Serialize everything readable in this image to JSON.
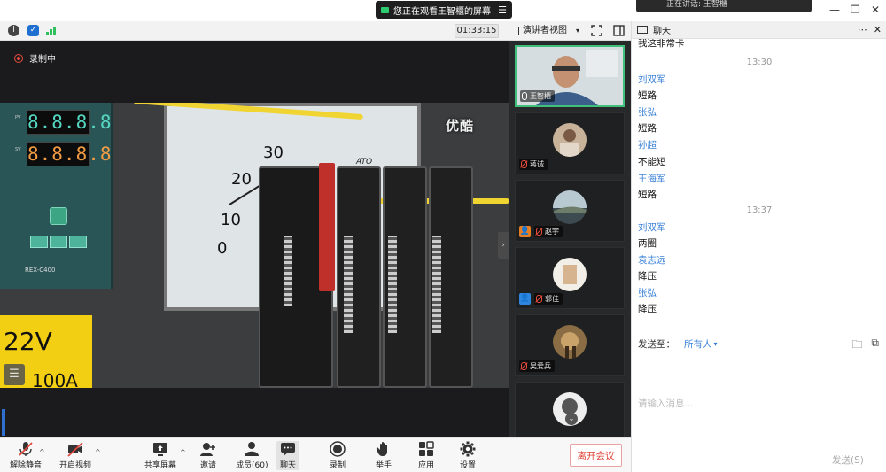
{
  "viewing_banner": {
    "text": "您正在观看王智櫃的屏幕"
  },
  "speaker_pill": {
    "text": "正在讲话: 王智櫃"
  },
  "toolbar": {
    "timer": "01:33:15",
    "view_mode": "演讲者视图",
    "view_caret": "▾"
  },
  "stage": {
    "recording_label": "录制中",
    "watermark": "优酷"
  },
  "shared_screen": {
    "display_pv": "8.8.8.8",
    "display_sv": "8.8.8.8",
    "pv_label": "PV",
    "sv_label": "SV",
    "controller_model": "REX-C400",
    "gauge_numbers": [
      "30",
      "20",
      "10",
      "0"
    ],
    "gauge_brand": "ATO",
    "label_voltage": "22V",
    "label_current": "100A"
  },
  "participants": [
    {
      "name": "王智櫃",
      "mic": "on",
      "active": true
    },
    {
      "name": "蒋诚",
      "mic": "off",
      "active": false
    },
    {
      "name": "赵宇",
      "mic": "off",
      "active": false
    },
    {
      "name": "郭佳",
      "mic": "off",
      "active": false
    },
    {
      "name": "吴爱兵",
      "mic": "off",
      "active": false
    }
  ],
  "chat": {
    "title": "聊天",
    "top_partial": "我这非常卡",
    "messages": [
      {
        "type": "time",
        "text": "13:30"
      },
      {
        "type": "sender",
        "text": "刘双军"
      },
      {
        "type": "text",
        "text": "短路"
      },
      {
        "type": "sender",
        "text": "张弘"
      },
      {
        "type": "text",
        "text": "短路"
      },
      {
        "type": "sender",
        "text": "孙超"
      },
      {
        "type": "text",
        "text": "不能短"
      },
      {
        "type": "sender",
        "text": "王海军"
      },
      {
        "type": "text",
        "text": "短路"
      },
      {
        "type": "time",
        "text": "13:37"
      },
      {
        "type": "sender",
        "text": "刘双军"
      },
      {
        "type": "text",
        "text": "两圈"
      },
      {
        "type": "sender",
        "text": "袁志远"
      },
      {
        "type": "text",
        "text": "降压"
      },
      {
        "type": "sender",
        "text": "张弘"
      },
      {
        "type": "text",
        "text": "降压"
      }
    ],
    "send_to_label": "发送至：",
    "send_to_value": "所有人",
    "input_placeholder": "请输入消息...",
    "send_label": "发送(S)"
  },
  "controls": {
    "unmute": "解除静音",
    "start_video": "开启视频",
    "share_screen": "共享屏幕",
    "invite": "邀请",
    "members": "成员(60)",
    "chat": "聊天",
    "record": "录制",
    "raise_hand": "举手",
    "apps": "应用",
    "settings": "设置",
    "leave": "离开会议"
  },
  "colors": {
    "accent_green": "#3fbf79",
    "link_blue": "#3b82d6",
    "danger_red": "#e0453a"
  }
}
